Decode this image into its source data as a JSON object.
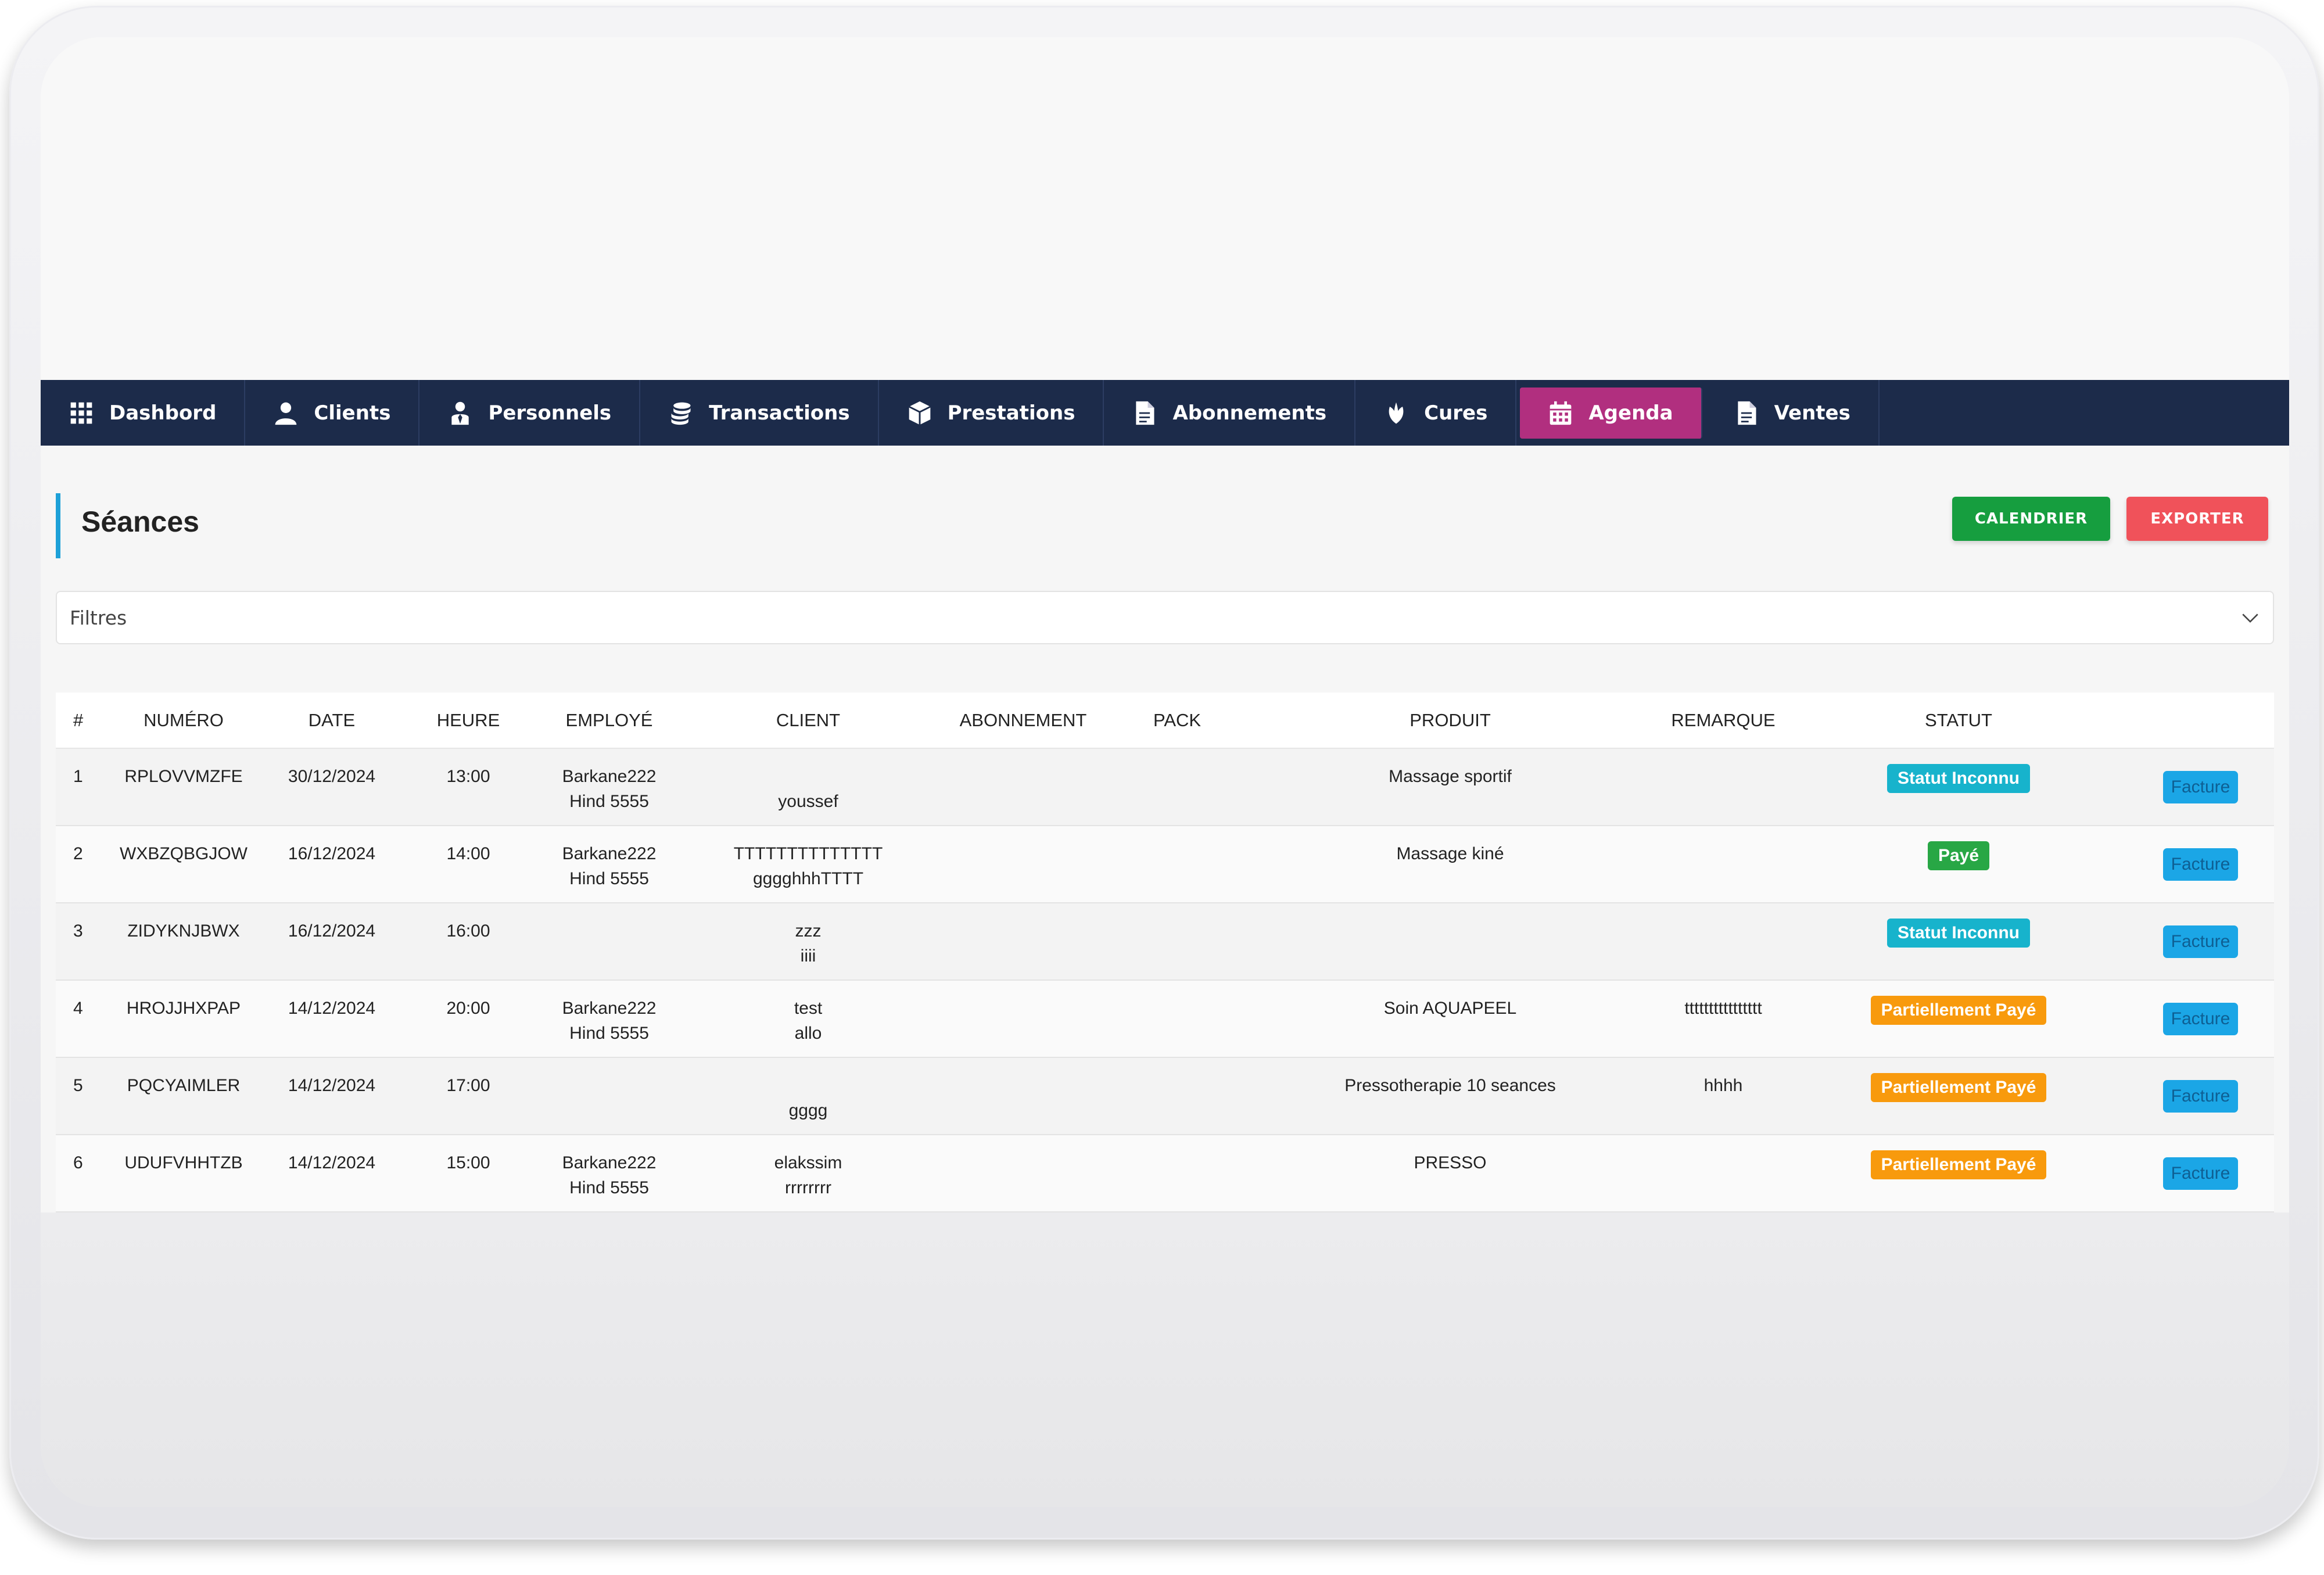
{
  "nav": {
    "items": [
      {
        "label": "Dashbord",
        "icon": "grid-icon"
      },
      {
        "label": "Clients",
        "icon": "user-icon"
      },
      {
        "label": "Personnels",
        "icon": "person-icon"
      },
      {
        "label": "Transactions",
        "icon": "coins-icon"
      },
      {
        "label": "Prestations",
        "icon": "box-icon"
      },
      {
        "label": "Abonnements",
        "icon": "document-icon"
      },
      {
        "label": "Cures",
        "icon": "leaf-icon"
      },
      {
        "label": "Agenda",
        "icon": "calendar-icon",
        "active": true
      },
      {
        "label": "Ventes",
        "icon": "document-icon"
      }
    ],
    "colors": {
      "bar": "#1c2b4a",
      "active": "#b12f7f"
    }
  },
  "page": {
    "title": "Séances",
    "calendar_button": "CALENDRIER",
    "export_button": "EXPORTER",
    "filters_label": "Filtres"
  },
  "table": {
    "headers": [
      "#",
      "NUMÉRO",
      "DATE",
      "HEURE",
      "EMPLOYÉ",
      "CLIENT",
      "ABONNEMENT",
      "PACK",
      "PRODUIT",
      "REMARQUE",
      "STATUT",
      ""
    ],
    "rows": [
      {
        "num": "1",
        "numero": "RPLOVVMZFE",
        "date": "30/12/2024",
        "heure": "13:00",
        "employe1": "Barkane222",
        "employe2": "Hind 5555",
        "client1": "",
        "client2": "youssef",
        "abonnement": "",
        "pack": "",
        "produit": "Massage sportif",
        "remarque": "",
        "statut": "Statut Inconnu",
        "statut_color": "#17b3cc",
        "action": "Facture"
      },
      {
        "num": "2",
        "numero": "WXBZQBGJOW",
        "date": "16/12/2024",
        "heure": "14:00",
        "employe1": "Barkane222",
        "employe2": "Hind 5555",
        "client1": "TTTTTTTTTTTTTT",
        "client2": "gggghhhTTTT",
        "abonnement": "",
        "pack": "",
        "produit": "Massage kiné",
        "remarque": "",
        "statut": "Payé",
        "statut_color": "#28a745",
        "action": "Facture"
      },
      {
        "num": "3",
        "numero": "ZIDYKNJBWX",
        "date": "16/12/2024",
        "heure": "16:00",
        "employe1": "",
        "employe2": "",
        "client1": "zzz",
        "client2": "iiii",
        "abonnement": "",
        "pack": "",
        "produit": "",
        "remarque": "",
        "statut": "Statut Inconnu",
        "statut_color": "#17b3cc",
        "action": "Facture"
      },
      {
        "num": "4",
        "numero": "HROJJHXPAP",
        "date": "14/12/2024",
        "heure": "20:00",
        "employe1": "Barkane222",
        "employe2": "Hind 5555",
        "client1": "test",
        "client2": "allo",
        "abonnement": "",
        "pack": "",
        "produit": "Soin AQUAPEEL",
        "remarque": "tttttttttttttttt",
        "statut": "Partiellement Payé",
        "statut_color": "#f89a0d",
        "action": "Facture"
      },
      {
        "num": "5",
        "numero": "PQCYAIMLER",
        "date": "14/12/2024",
        "heure": "17:00",
        "employe1": "",
        "employe2": "",
        "client1": "",
        "client2": "gggg",
        "abonnement": "",
        "pack": "",
        "produit": "Pressotherapie 10 seances",
        "remarque": "hhhh",
        "statut": "Partiellement Payé",
        "statut_color": "#f89a0d",
        "action": "Facture"
      },
      {
        "num": "6",
        "numero": "UDUFVHHTZB",
        "date": "14/12/2024",
        "heure": "15:00",
        "employe1": "Barkane222",
        "employe2": "Hind 5555",
        "client1": "elakssim",
        "client2": "rrrrrrrr",
        "abonnement": "",
        "pack": "",
        "produit": "PRESSO",
        "remarque": "",
        "statut": "Partiellement Payé",
        "statut_color": "#f89a0d",
        "action": "Facture"
      }
    ]
  }
}
